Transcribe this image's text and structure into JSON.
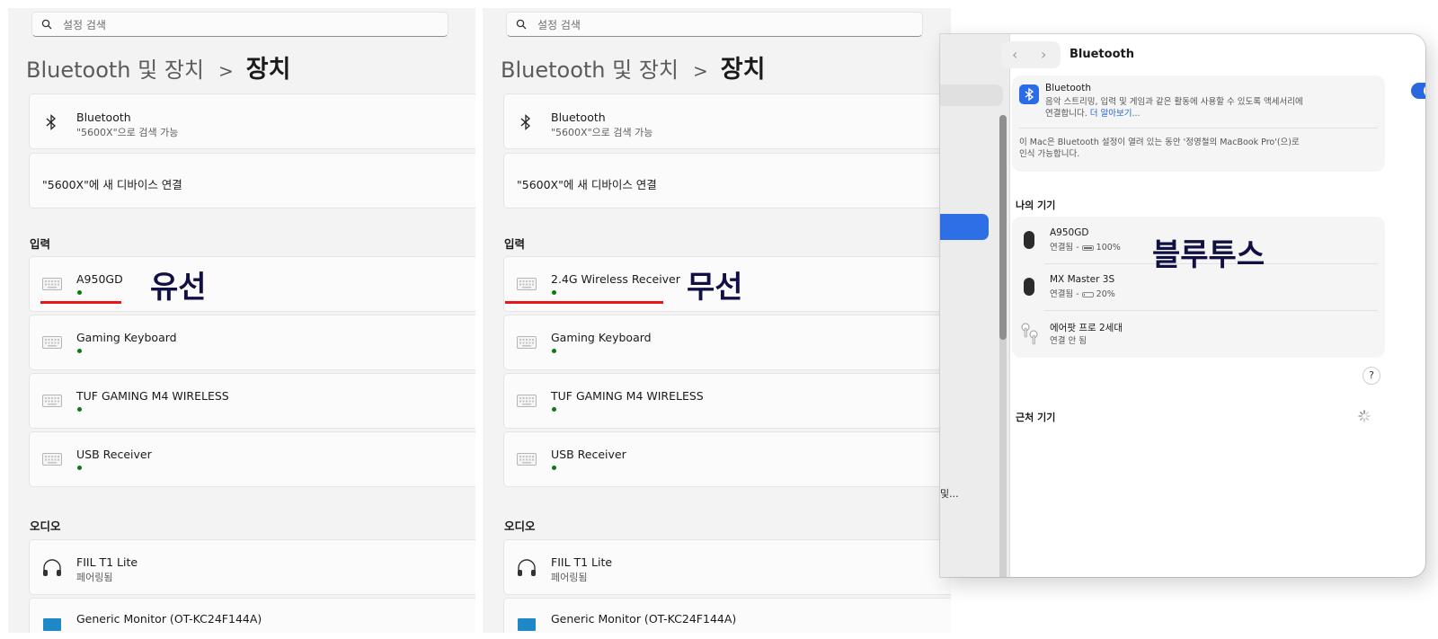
{
  "windows": [
    {
      "search_placeholder": "설정 검색",
      "breadcrumb_parent": "Bluetooth 및 장치",
      "breadcrumb_sep": ">",
      "breadcrumb_current": "장치",
      "bluetooth": {
        "title": "Bluetooth",
        "subtitle": "\"5600X\"으로 검색 가능"
      },
      "pair_new": "\"5600X\"에 새 디바이스 연결",
      "input_section": "입력",
      "input_devices": [
        "A950GD",
        "Gaming Keyboard",
        "TUF GAMING M4 WIRELESS",
        "USB Receiver"
      ],
      "audio_section": "오디오",
      "audio_device": {
        "title": "FIIL T1 Lite",
        "subtitle": "페어링됨"
      },
      "monitor": "Generic Monitor (OT-KC24F144A)",
      "annotation": "유선"
    },
    {
      "search_placeholder": "설정 검색",
      "breadcrumb_parent": "Bluetooth 및 장치",
      "breadcrumb_sep": ">",
      "breadcrumb_current": "장치",
      "bluetooth": {
        "title": "Bluetooth",
        "subtitle": "\"5600X\"으로 검색 가능"
      },
      "pair_new": "\"5600X\"에 새 디바이스 연결",
      "input_section": "입력",
      "input_devices": [
        "2.4G Wireless Receiver",
        "Gaming Keyboard",
        "TUF GAMING M4 WIRELESS",
        "USB Receiver"
      ],
      "audio_section": "오디오",
      "audio_device": {
        "title": "FIIL T1 Lite",
        "subtitle": "페어링됨"
      },
      "monitor": "Generic Monitor (OT-KC24F144A)",
      "annotation": "무선"
    }
  ],
  "mac": {
    "sidebar_truncated": "및...",
    "title": "Bluetooth",
    "bt_title": "Bluetooth",
    "bt_desc_1": "음악 스트리밍, 입력 및 게임과 같은 활동에 사용할 수 있도록 액세서리에",
    "bt_desc_2": "연결합니다.",
    "bt_link": "더 알아보기...",
    "discoverable_1": "이 Mac은 Bluetooth 설정이 열려 있는 동안 '정영철의 MacBook Pro'(으)로",
    "discoverable_2": "인식 가능합니다.",
    "my_devices_label": "나의 기기",
    "devices": [
      {
        "name": "A950GD",
        "status": "연결됨 -",
        "battery": "100%",
        "battery_level": 1.0
      },
      {
        "name": "MX Master 3S",
        "status": "연결됨 -",
        "battery": "20%",
        "battery_level": 0.2
      },
      {
        "name": "에어팟 프로 2세대",
        "status": "연결 안 됨"
      }
    ],
    "help": "?",
    "nearby_label": "근처 기기",
    "annotation": "블루투스"
  },
  "colors": {
    "accent": "#2a68de",
    "connected_dot": "#0e7a0d",
    "annotation_line": "#e8161b",
    "annotation_text": "#101044"
  }
}
